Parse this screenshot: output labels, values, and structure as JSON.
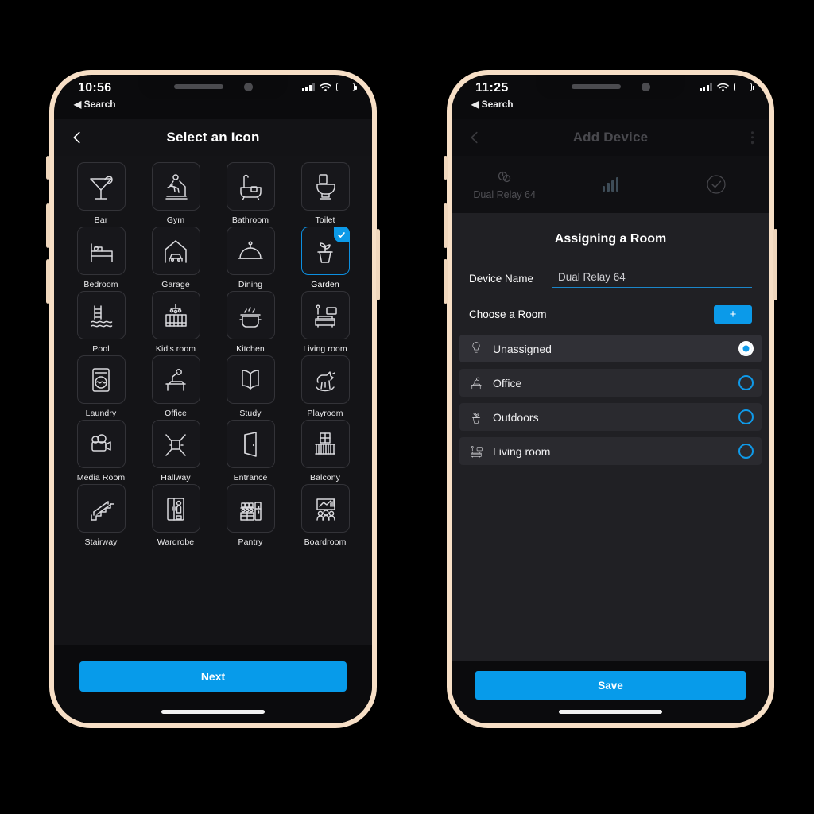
{
  "left_phone": {
    "status_bar": {
      "time": "10:56",
      "back_app": "◀ Search"
    },
    "nav": {
      "title": "Select an Icon",
      "back_icon": "chevron-left-icon"
    },
    "icons": [
      {
        "label": "Bar",
        "icon": "cocktail-icon",
        "selected": false
      },
      {
        "label": "Gym",
        "icon": "treadmill-icon",
        "selected": false
      },
      {
        "label": "Bathroom",
        "icon": "bathtub-icon",
        "selected": false
      },
      {
        "label": "Toilet",
        "icon": "toilet-icon",
        "selected": false
      },
      {
        "label": "Bedroom",
        "icon": "bed-icon",
        "selected": false
      },
      {
        "label": "Garage",
        "icon": "garage-car-icon",
        "selected": false
      },
      {
        "label": "Dining",
        "icon": "cloche-icon",
        "selected": false
      },
      {
        "label": "Garden",
        "icon": "potted-plant-icon",
        "selected": true
      },
      {
        "label": "Pool",
        "icon": "pool-ladder-icon",
        "selected": false
      },
      {
        "label": "Kid's room",
        "icon": "crib-icon",
        "selected": false
      },
      {
        "label": "Kitchen",
        "icon": "cooking-pot-icon",
        "selected": false
      },
      {
        "label": "Living room",
        "icon": "sofa-tv-icon",
        "selected": false
      },
      {
        "label": "Laundry",
        "icon": "washer-icon",
        "selected": false
      },
      {
        "label": "Office",
        "icon": "desk-lamp-icon",
        "selected": false
      },
      {
        "label": "Study",
        "icon": "open-book-icon",
        "selected": false
      },
      {
        "label": "Playroom",
        "icon": "rocking-horse-icon",
        "selected": false
      },
      {
        "label": "Media Room",
        "icon": "film-camera-icon",
        "selected": false
      },
      {
        "label": "Hallway",
        "icon": "corridor-icon",
        "selected": false
      },
      {
        "label": "Entrance",
        "icon": "open-door-icon",
        "selected": false
      },
      {
        "label": "Balcony",
        "icon": "balcony-icon",
        "selected": false
      },
      {
        "label": "Stairway",
        "icon": "stairs-icon",
        "selected": false
      },
      {
        "label": "Wardrobe",
        "icon": "wardrobe-icon",
        "selected": false
      },
      {
        "label": "Pantry",
        "icon": "pantry-icon",
        "selected": false
      },
      {
        "label": "Boardroom",
        "icon": "boardroom-icon",
        "selected": false
      }
    ],
    "next_button": "Next"
  },
  "right_phone": {
    "status_bar": {
      "time": "11:25",
      "back_app": "◀ Search"
    },
    "nav": {
      "title": "Add Device",
      "back_icon": "chevron-left-icon",
      "menu_icon": "kebab-menu-icon"
    },
    "steps": [
      {
        "label": "Dual Relay 64",
        "icon": "relay-device-icon"
      },
      {
        "label": "",
        "icon": "signal-bars-icon"
      },
      {
        "label": "",
        "icon": "check-circle-icon"
      }
    ],
    "sheet": {
      "title": "Assigning a Room",
      "device_name_label": "Device Name",
      "device_name_value": "Dual Relay 64",
      "choose_room_label": "Choose a Room",
      "add_room_button": "+",
      "rooms": [
        {
          "name": "Unassigned",
          "icon": "bulb-icon",
          "selected": true
        },
        {
          "name": "Office",
          "icon": "desk-lamp-icon",
          "selected": false
        },
        {
          "name": "Outdoors",
          "icon": "potted-plant-icon",
          "selected": false
        },
        {
          "name": "Living room",
          "icon": "sofa-tv-icon",
          "selected": false
        }
      ]
    },
    "save_button": "Save"
  },
  "colors": {
    "accent": "#079bea",
    "frame": "#f7dfc6",
    "screen_bg": "#0b0b0d",
    "sheet_bg": "#202024",
    "selected_border": "#0c8fe0"
  }
}
